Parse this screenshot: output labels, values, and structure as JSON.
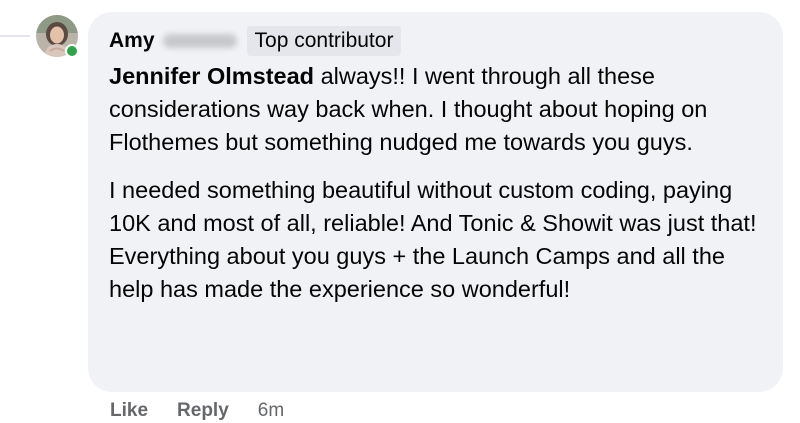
{
  "comment": {
    "author": {
      "first_name": "Amy",
      "last_name_redacted": true,
      "badge": "Top contributor",
      "online": true
    },
    "mention": "Jennifer Olmstead",
    "paragraph1_rest": " always!! I went through all these considerations way back when. I thought about hoping on Flothemes but something nudged me towards you guys.",
    "paragraph2_line1": "I needed something beautiful without custom coding, paying 10K and most of all, reliable! And Tonic & Showit was just that!",
    "paragraph2_line2": "Everything about you guys + the Launch Camps and all the help has made the experience so wonderful!"
  },
  "actions": {
    "like_label": "Like",
    "reply_label": "Reply",
    "timestamp": "6m"
  },
  "colors": {
    "bubble_bg": "#f0f2f5",
    "badge_bg": "#e4e6eb",
    "text_primary": "#050505",
    "text_secondary": "#65676b",
    "online_green": "#31a24c"
  }
}
